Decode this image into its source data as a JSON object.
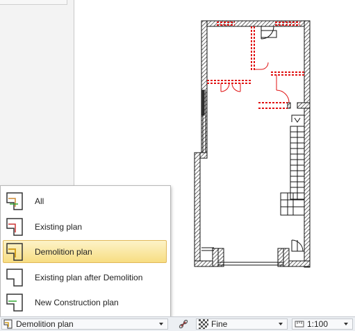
{
  "plan_menu": {
    "items": [
      {
        "label": "All",
        "icon": "plan-all-icon",
        "selected": false
      },
      {
        "label": "Existing plan",
        "icon": "plan-existing-icon",
        "selected": false
      },
      {
        "label": "Demolition plan",
        "icon": "plan-demolition-icon",
        "selected": true
      },
      {
        "label": "Existing plan after Demolition",
        "icon": "plan-existing-after-demolition-icon",
        "selected": false
      },
      {
        "label": "New Construction plan",
        "icon": "plan-new-construction-icon",
        "selected": false
      }
    ]
  },
  "statusbar": {
    "plan_select_value": "Demolition plan",
    "link_icon": "link-icon",
    "fill_icon": "checker-fill-icon",
    "quality_value": "Fine",
    "scale_icon": "ruler-icon",
    "scale_value": "1:100"
  },
  "colors": {
    "existing_wall": "#111111",
    "demolition": "#e01010",
    "selected_highlight": "#f7dd82",
    "statusbar_bg": "#eceff3"
  }
}
